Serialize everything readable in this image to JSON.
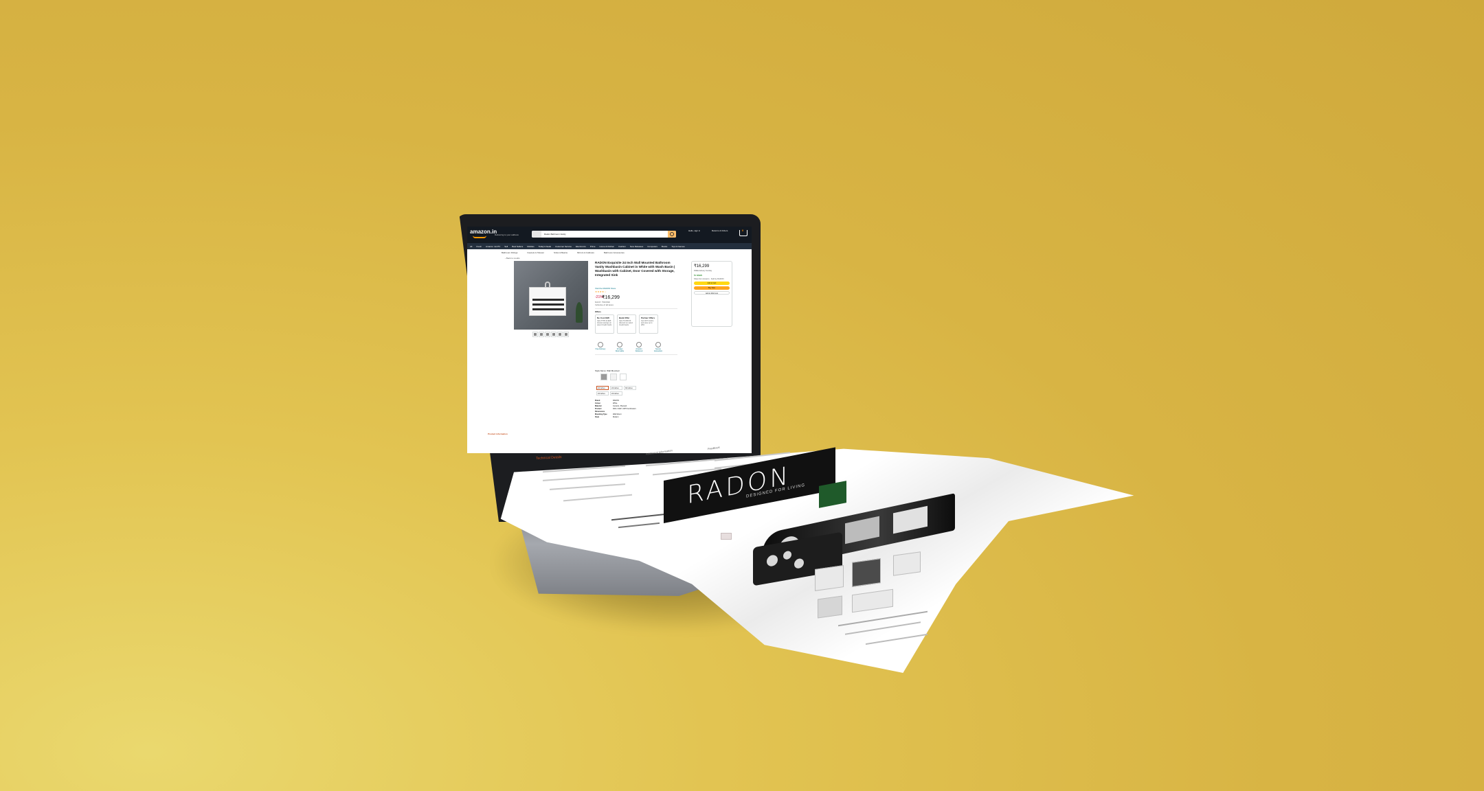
{
  "amazon": {
    "logo": "amazon.in",
    "location": "Delivering to your address",
    "search_text": "Radon Bathroom Vanity",
    "nav_items": [
      "All",
      "Fresh",
      "Amazon miniTV",
      "Sell",
      "Best Sellers",
      "Mobiles",
      "Today's Deals",
      "Customer Service",
      "Electronics",
      "Prime",
      "Home & Kitchen",
      "Fashion",
      "New Releases",
      "Computers",
      "Books",
      "Toys & Games"
    ],
    "subnav_items": [
      "Bathroom Fittings",
      "Faucets & Shower",
      "Sinks & Basins",
      "Mirrors & Cabinets",
      "Bathroom Accessories"
    ],
    "account_label": "Hello, sign in",
    "returns_label": "Returns & Orders",
    "cart_count": "0",
    "breadcrumb": "‹ Back to results"
  },
  "product": {
    "title": "RADON Exquisite 24 Inch Wall Mounted Bathroom Vanity Washbasin Cabinet in White with Wash Basin | Washbasin with Cabinet, Door Covered with Storage, Integrated Sink",
    "brand_link": "Visit the RADON Store",
    "stars": "★★★★☆",
    "discount": "-21%",
    "price": "₹16,299",
    "mrp": "M.R.P.: ₹20,599",
    "tax": "Inclusive of all taxes",
    "offers_label": "Offers",
    "offer_cards": [
      {
        "title": "No Cost EMI",
        "body": "Upto ₹735.12 EMI interest savings on select Credit Cards"
      },
      {
        "title": "Bank Offer",
        "body": "Upto ₹1,500.00 discount on select Credit Cards"
      },
      {
        "title": "Partner Offers",
        "body": "Get GST invoice and save up to 28%"
      }
    ],
    "services": [
      "Free Delivery",
      "10 days Returnable",
      "Amazon Delivered",
      "Secure transaction"
    ],
    "style_label": "Style Name: Wall Mounted",
    "size_chips": [
      "24 inches",
      "24 inches",
      "30 inches",
      "24 inches",
      "24 inches"
    ],
    "specs": [
      {
        "k": "Brand",
        "v": "RADON"
      },
      {
        "k": "Colour",
        "v": "White"
      },
      {
        "k": "Material",
        "v": "Ceramic, Plywood"
      },
      {
        "k": "Product Dimensions",
        "v": "46D x 61W x 48H Centimeters"
      },
      {
        "k": "Mounting Type",
        "v": "Wall Mount"
      },
      {
        "k": "Style",
        "v": "Modern"
      }
    ]
  },
  "buybox": {
    "price": "₹16,299",
    "delivery": "FREE delivery Sunday",
    "stock": "In stock",
    "ships": "Ships from Amazon · Sold by RADON",
    "add_to_cart": "Add to Cart",
    "buy_now": "Buy Now",
    "wishlist": "Add to Wish List"
  },
  "lower": {
    "heading": "Product information",
    "technical": "Technical Details",
    "additional": "Additional Information",
    "feedback": "Feedback"
  },
  "paper": {
    "brand_word": "RADON",
    "brand_sub": "DESIGNED FOR LIVING"
  },
  "colors": {
    "background": "#d8b444",
    "amazon_header": "#131921",
    "amazon_nav": "#232f3e",
    "accent_orange": "#febd69",
    "price_red": "#cc0c39",
    "cart_button": "#ffd814",
    "buy_button": "#ffa41c"
  }
}
